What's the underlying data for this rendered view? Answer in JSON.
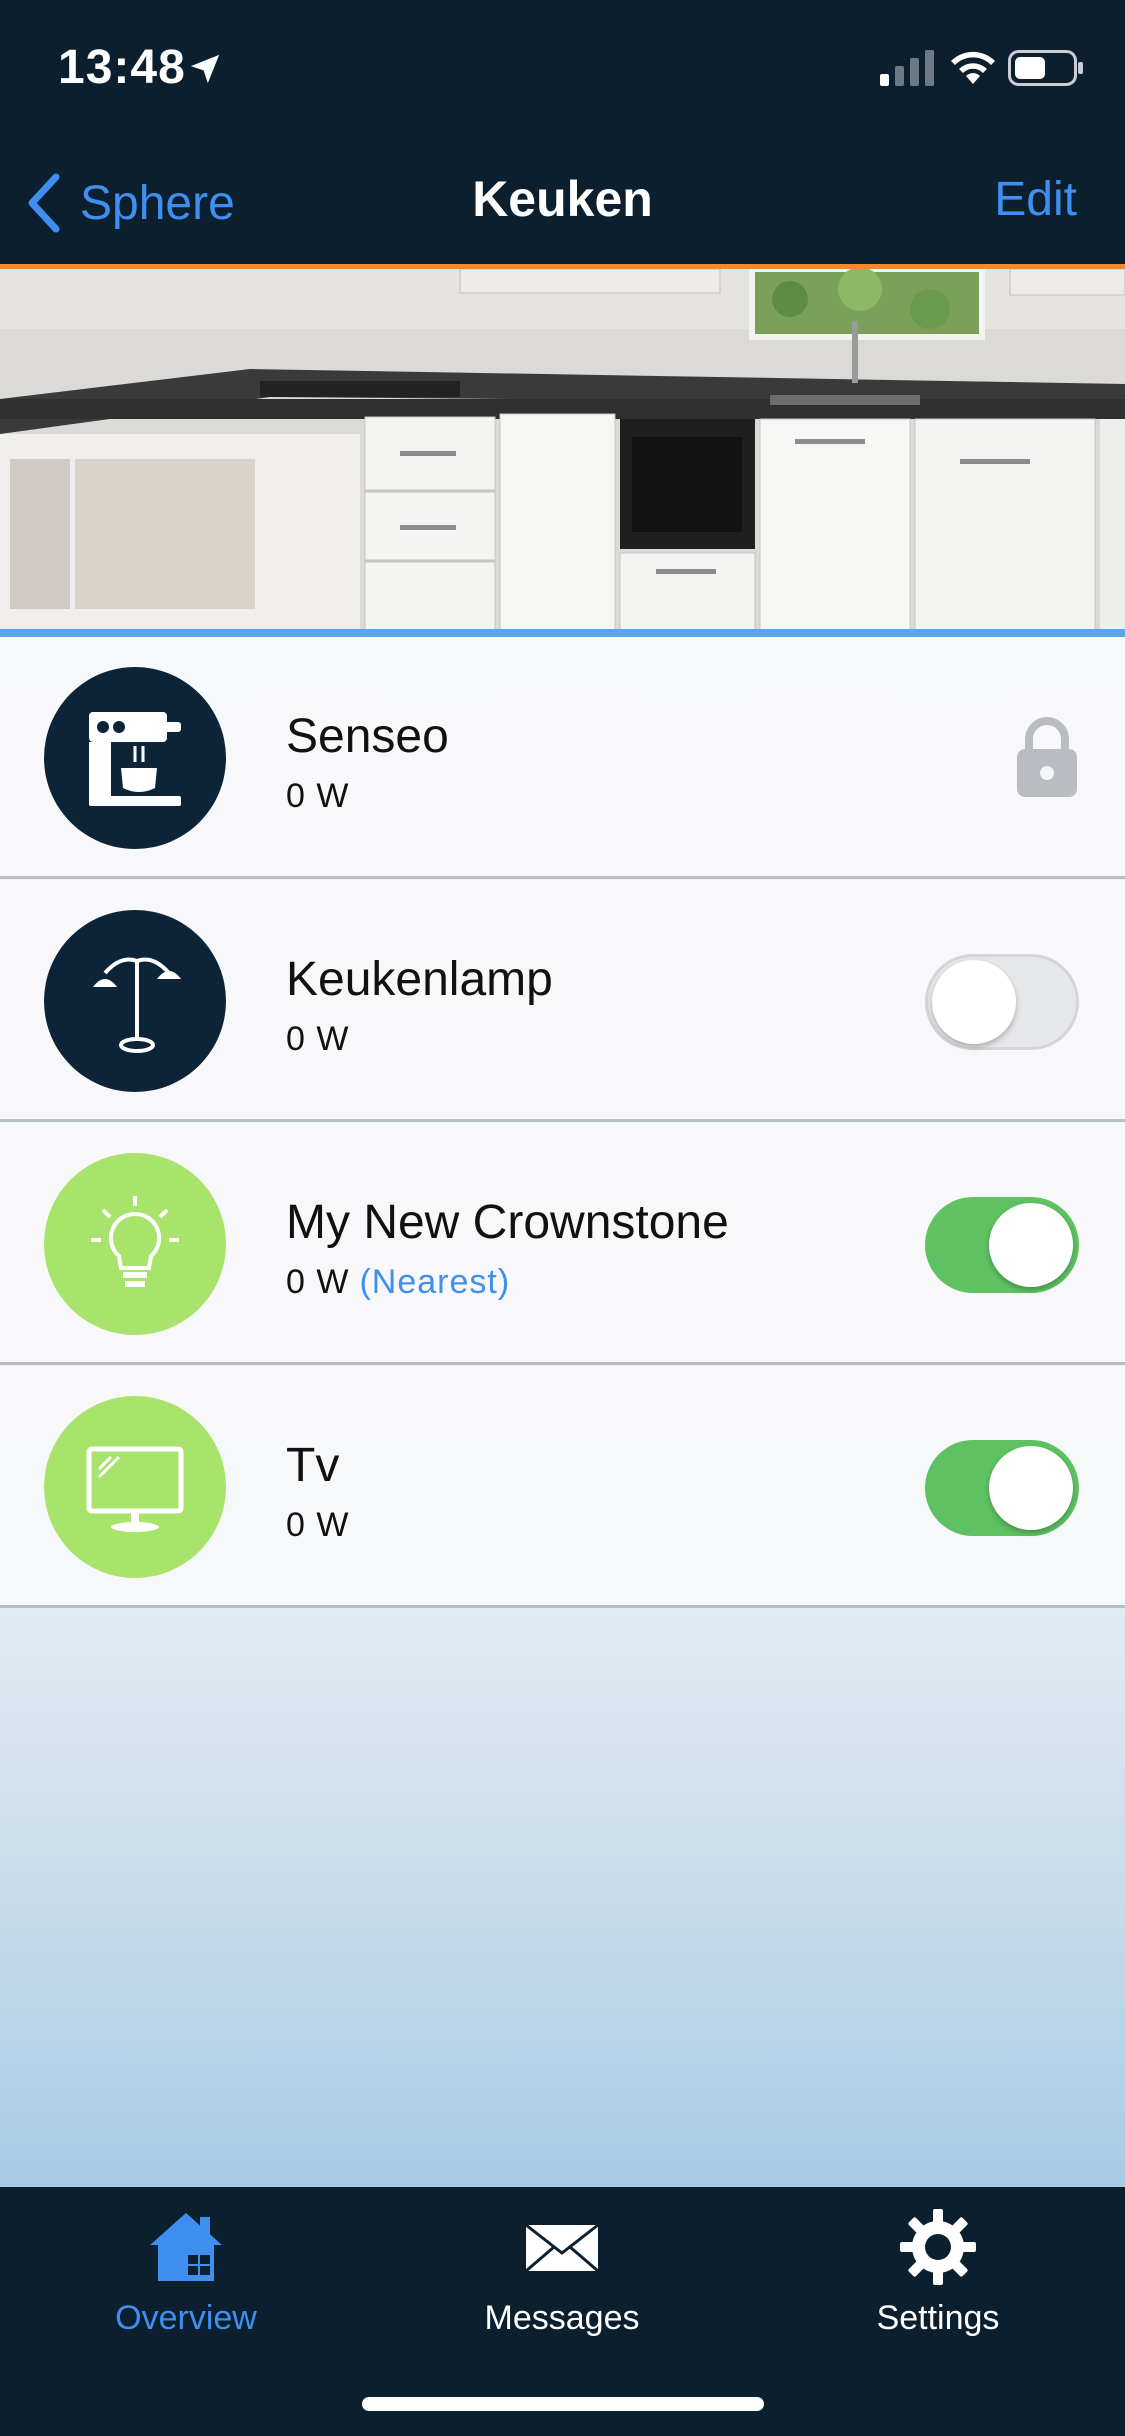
{
  "status_bar": {
    "time": "13:48",
    "icons": [
      "location-arrow-icon",
      "cellular-signal-icon",
      "wifi-icon",
      "battery-icon"
    ]
  },
  "nav": {
    "back_label": "Sphere",
    "title": "Keuken",
    "edit_label": "Edit"
  },
  "devices": [
    {
      "name": "Senseo",
      "power": "0 W",
      "icon": "coffee-machine-icon",
      "icon_bg": "#0d2438",
      "control": "lock"
    },
    {
      "name": "Keukenlamp",
      "power": "0 W",
      "icon": "floor-lamp-icon",
      "icon_bg": "#0d2438",
      "control": "toggle",
      "on": false
    },
    {
      "name": "My New Crownstone",
      "power": "0 W",
      "nearest": "(Nearest)",
      "icon": "light-bulb-icon",
      "icon_bg": "#a8e46b",
      "control": "toggle",
      "on": true
    },
    {
      "name": "Tv",
      "power": "0 W",
      "icon": "tv-monitor-icon",
      "icon_bg": "#a8e46b",
      "control": "toggle",
      "on": true
    }
  ],
  "tabs": [
    {
      "label": "Overview",
      "icon": "home-icon",
      "active": true
    },
    {
      "label": "Messages",
      "icon": "envelope-icon",
      "active": false
    },
    {
      "label": "Settings",
      "icon": "gear-icon",
      "active": false
    }
  ],
  "colors": {
    "nav_bg": "#0b1f2e",
    "accent_blue": "#3f8ff0",
    "accent_orange": "#f08a2a",
    "toggle_on": "#5ec262",
    "icon_green": "#a8e46b",
    "icon_dark": "#0d2438"
  }
}
